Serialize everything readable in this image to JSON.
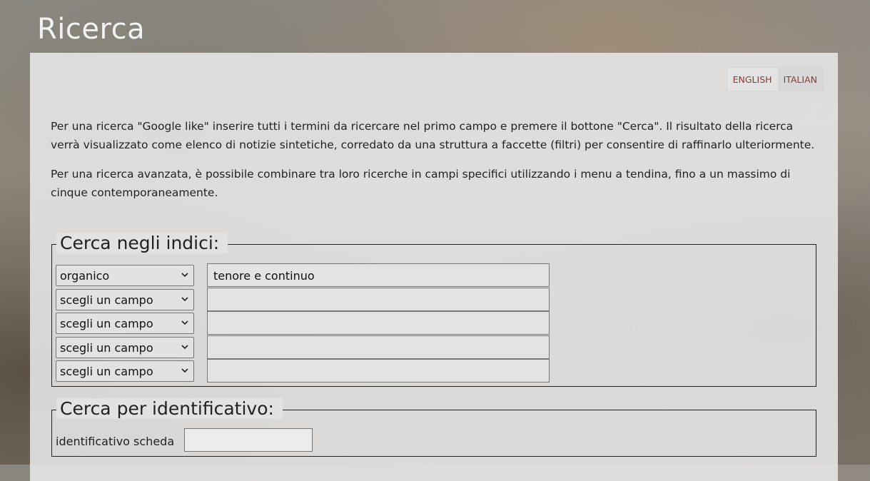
{
  "page": {
    "title": "Ricerca"
  },
  "language": {
    "english": "ENGLISH",
    "italian": "ITALIAN",
    "active": "italian"
  },
  "intro": {
    "p1": "Per una ricerca \"Google like\" inserire tutti i termini da ricercare nel primo campo e premere il bottone \"Cerca\".  Il risultato della ricerca verrà visualizzato come elenco di notizie sintetiche, corredato da una struttura a faccette (filtri) per consentire di raffinarlo ulteriormente.",
    "p2": "Per una ricerca avanzata, è possibile combinare tra loro ricerche in campi specifici utilizzando i menu a tendina, fino a un massimo di cinque contemporaneamente."
  },
  "index_search": {
    "legend": "Cerca negli indici:",
    "rows": [
      {
        "field": "organico",
        "value": "tenore e continuo"
      },
      {
        "field": "scegli un campo",
        "value": ""
      },
      {
        "field": "scegli un campo",
        "value": ""
      },
      {
        "field": "scegli un campo",
        "value": ""
      },
      {
        "field": "scegli un campo",
        "value": ""
      }
    ]
  },
  "id_search": {
    "legend": "Cerca per identificativo:",
    "label": "identificativo scheda",
    "value": ""
  },
  "colors": {
    "accent": "#8a3a3a",
    "panel": "#e8e8e8"
  }
}
